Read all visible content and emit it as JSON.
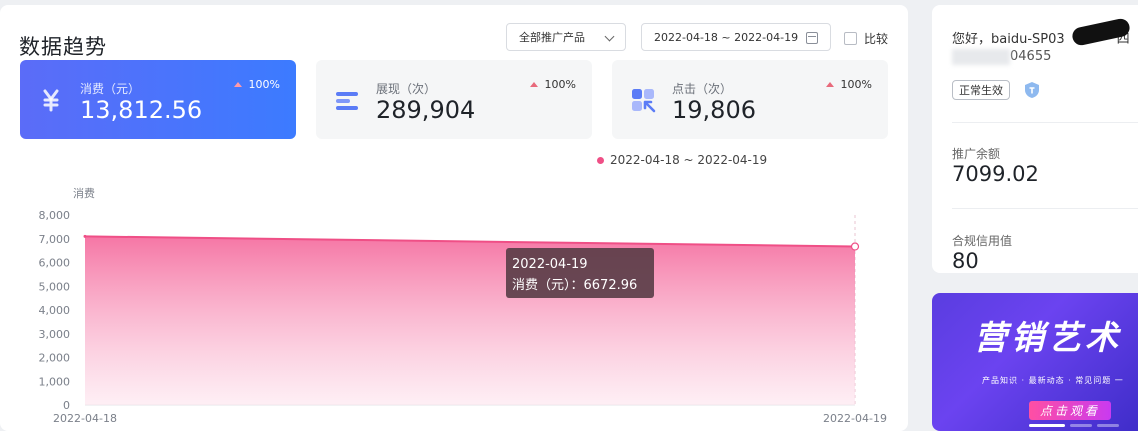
{
  "header": {
    "title": "数据趋势",
    "product_select": "全部推广产品",
    "date_range": "2022-04-18 ~ 2022-04-19",
    "compare_label": "比较",
    "compare_checked": false
  },
  "metrics": [
    {
      "label": "消费（元）",
      "value": "13,812.56",
      "change": "100%",
      "icon": "yen-icon",
      "active": true
    },
    {
      "label": "展现（次）",
      "value": "289,904",
      "change": "100%",
      "icon": "bars-icon",
      "active": false
    },
    {
      "label": "点击（次）",
      "value": "19,806",
      "change": "100%",
      "icon": "grid-click-icon",
      "active": false
    }
  ],
  "legend": {
    "label": "2022-04-18 ~ 2022-04-19",
    "color": "#ef4f86"
  },
  "chart_data": {
    "type": "area",
    "ylabel": "消费",
    "x": [
      "2022-04-18",
      "2022-04-19"
    ],
    "series": [
      {
        "name": "2022-04-18 ~ 2022-04-19",
        "values": [
          7100,
          6672.96
        ],
        "color": "#ef4f86"
      }
    ],
    "ylim": [
      0,
      8000
    ],
    "yticks": [
      "0",
      "1,000",
      "2,000",
      "3,000",
      "4,000",
      "5,000",
      "6,000",
      "7,000",
      "8,000"
    ],
    "grid": false
  },
  "tooltip": {
    "date": "2022-04-19",
    "text": "消费（元）：6672.96"
  },
  "account": {
    "greeting": "您好，baidu-SP03",
    "greeting_tail": "四",
    "account_id_tail": "04655",
    "status_badge": "正常生效",
    "balance_label": "推广余额",
    "balance_value": "7099.02",
    "credit_label": "合规信用值",
    "credit_value": "80"
  },
  "banner": {
    "title": "营销艺术",
    "subtitle": "产品知识 · 最新动态 · 常见问题 一",
    "button": "点击观看"
  }
}
